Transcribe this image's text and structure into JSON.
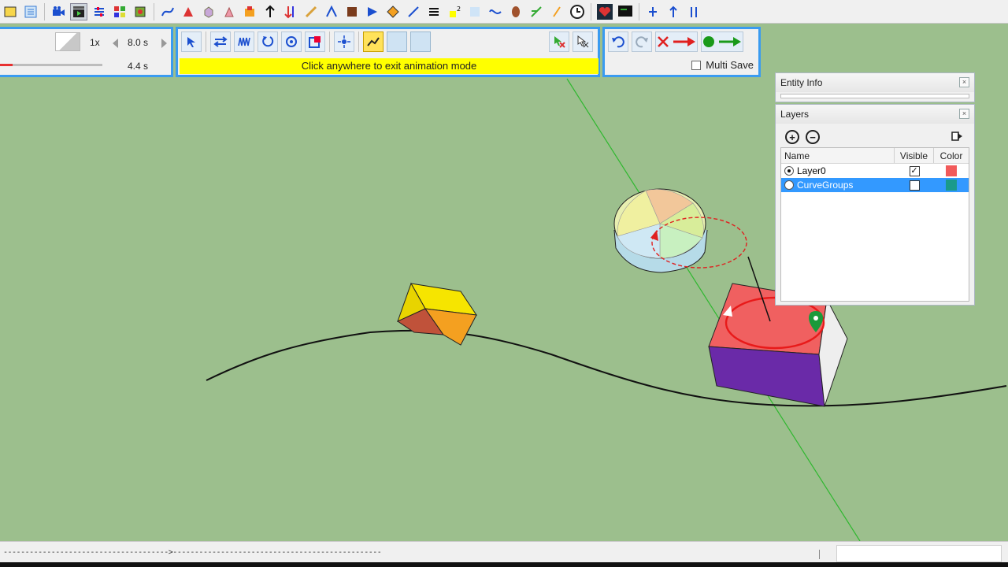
{
  "animation": {
    "speed": "1x",
    "total_time": "8.0 s",
    "current_time": "4.4 s",
    "exit_message": "Click anywhere to exit animation mode",
    "multi_save_label": "Multi Save",
    "progress": 0.12
  },
  "entity_info": {
    "title": "Entity Info",
    "close_glyph": "×"
  },
  "layers": {
    "title": "Layers",
    "close_glyph": "×",
    "add_glyph": "+",
    "remove_glyph": "−",
    "columns": {
      "name": "Name",
      "visible": "Visible",
      "color": "Color"
    },
    "rows": [
      {
        "name": "Layer0",
        "active": true,
        "visible": true,
        "visible_glyph": "✓",
        "color": "#f25a5a",
        "selected": false
      },
      {
        "name": "CurveGroups",
        "active": false,
        "visible": false,
        "visible_glyph": "",
        "color": "#1a9a8a",
        "selected": true
      }
    ]
  },
  "status_bar": {
    "text": "-------------------------------------->------------------------------------------------"
  },
  "colors": {
    "ground": "#9cbf8d",
    "accent": "#3a9bf0",
    "banner": "#ffff00",
    "selection": "#3399ff"
  },
  "icons": {
    "top_toolbar": [
      "layers-icon",
      "outliner-icon",
      "camera-icon",
      "clapboard-icon",
      "settings-icon",
      "components-icon",
      "materials-icon",
      "tool-icon",
      "pen-icon",
      "curve-icon",
      "arrow-icon",
      "circle-icon",
      "clock-icon",
      "heart-icon",
      "monitor-icon",
      "up-arrow-icon"
    ]
  }
}
